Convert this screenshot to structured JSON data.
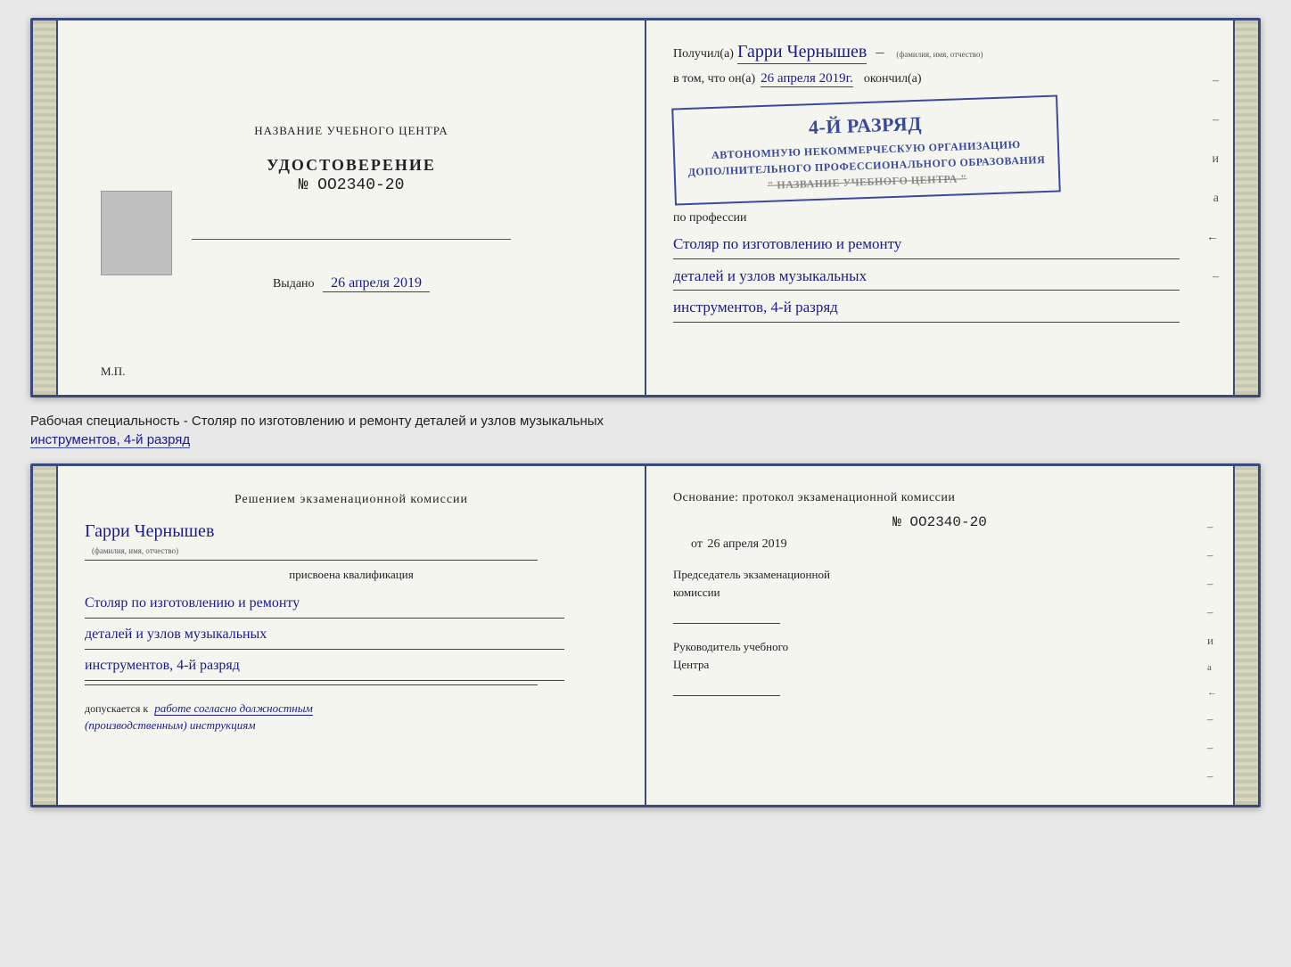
{
  "top": {
    "left": {
      "org_name": "НАЗВАНИЕ УЧЕБНОГО ЦЕНТРА",
      "cert_title": "УДОСТОВЕРЕНИЕ",
      "cert_number": "№ OO2340-20",
      "issued_label": "Выдано",
      "issued_date": "26 апреля 2019",
      "mp_label": "М.П."
    },
    "right": {
      "received_label": "Получил(а)",
      "name_handwritten": "Гарри Чернышев",
      "name_sub": "(фамилия, имя, отчество)",
      "dash1": "–",
      "in_that_label": "в том, что он(а)",
      "date_handwritten": "26 апреля 2019г.",
      "finished_label": "окончил(а)",
      "stamp_line1": "4-й разряд",
      "stamp_line2": "АВТОНОМНУЮ НЕКОММЕРЧЕСКУЮ ОРГАНИЗАЦИЮ",
      "stamp_line3": "ДОПОЛНИТЕЛЬНОГО ПРОФЕССИОНАЛЬНОГО ОБРАЗОВАНИЯ",
      "stamp_line4": "\" НАЗВАНИЕ УЧЕБНОГО ЦЕНТРА \"",
      "and_label": "и",
      "a_label": "а",
      "left_arrow": "←",
      "profession_label": "по профессии",
      "prof_line1": "Столяр по изготовлению и ремонту",
      "prof_line2": "деталей и узлов музыкальных",
      "prof_line3": "инструментов, 4-й разряд"
    }
  },
  "caption": {
    "text": "Рабочая специальность - Столяр по изготовлению и ремонту деталей и узлов музыкальных",
    "text2_underline": "инструментов, 4-й разряд"
  },
  "bottom": {
    "left": {
      "section_title": "Решением  экзаменационной  комиссии",
      "name_handwritten": "Гарри Чернышев",
      "name_sub": "(фамилия, имя, отчество)",
      "assigned_label": "присвоена квалификация",
      "qual_line1": "Столяр по изготовлению и ремонту",
      "qual_line2": "деталей и узлов музыкальных",
      "qual_line3": "инструментов, 4-й разряд",
      "допускается_label": "допускается к",
      "допускается_text_italic": "работе согласно должностным",
      "допускается_text2_italic": "(производственным) инструкциям"
    },
    "right": {
      "osnov_label": "Основание: протокол экзаменационной  комиссии",
      "number_label": "№  OO2340-20",
      "date_prefix": "от",
      "date_value": "26 апреля 2019",
      "chairman_label": "Председатель экзаменационной",
      "chairman_label2": "комиссии",
      "director_label": "Руководитель учебного",
      "director_label2": "Центра",
      "dash_items": [
        "–",
        "–",
        "–",
        "и",
        "а",
        "←",
        "–",
        "–",
        "–",
        "–"
      ]
    }
  }
}
